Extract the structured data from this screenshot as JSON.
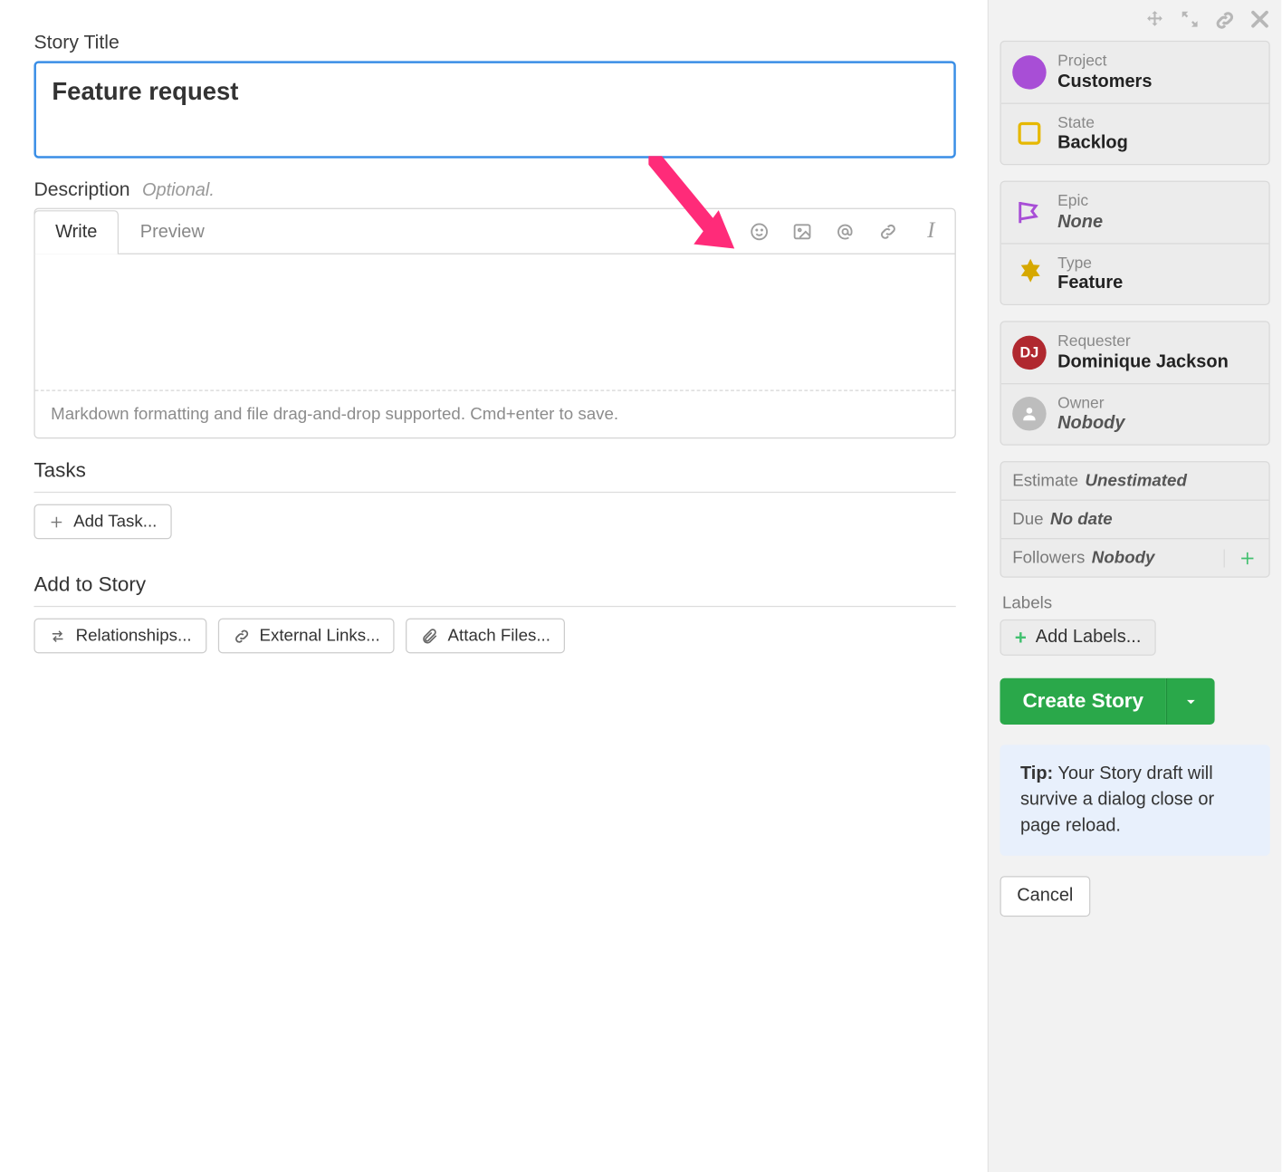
{
  "title": {
    "label": "Story Title",
    "value": "Feature request"
  },
  "description": {
    "label": "Description",
    "optional": "Optional.",
    "tabs": {
      "write": "Write",
      "preview": "Preview"
    },
    "hint": "Markdown formatting and file drag-and-drop supported. Cmd+enter to save."
  },
  "tasks": {
    "label": "Tasks",
    "add_button": "Add Task..."
  },
  "add_to_story": {
    "label": "Add to Story",
    "relationships": "Relationships...",
    "external_links": "External Links...",
    "attach_files": "Attach Files..."
  },
  "side": {
    "project": {
      "label": "Project",
      "value": "Customers"
    },
    "state": {
      "label": "State",
      "value": "Backlog"
    },
    "epic": {
      "label": "Epic",
      "value": "None"
    },
    "type": {
      "label": "Type",
      "value": "Feature"
    },
    "requester": {
      "label": "Requester",
      "value": "Dominique Jackson",
      "avatar": "DJ"
    },
    "owner": {
      "label": "Owner",
      "value": "Nobody"
    },
    "estimate": {
      "label": "Estimate",
      "value": "Unestimated"
    },
    "due": {
      "label": "Due",
      "value": "No date"
    },
    "followers": {
      "label": "Followers",
      "value": "Nobody"
    },
    "labels_heading": "Labels",
    "add_labels": "Add Labels...",
    "create": "Create Story",
    "tip_prefix": "Tip:",
    "tip_body": " Your Story draft will survive a dialog close or page reload.",
    "cancel": "Cancel"
  }
}
